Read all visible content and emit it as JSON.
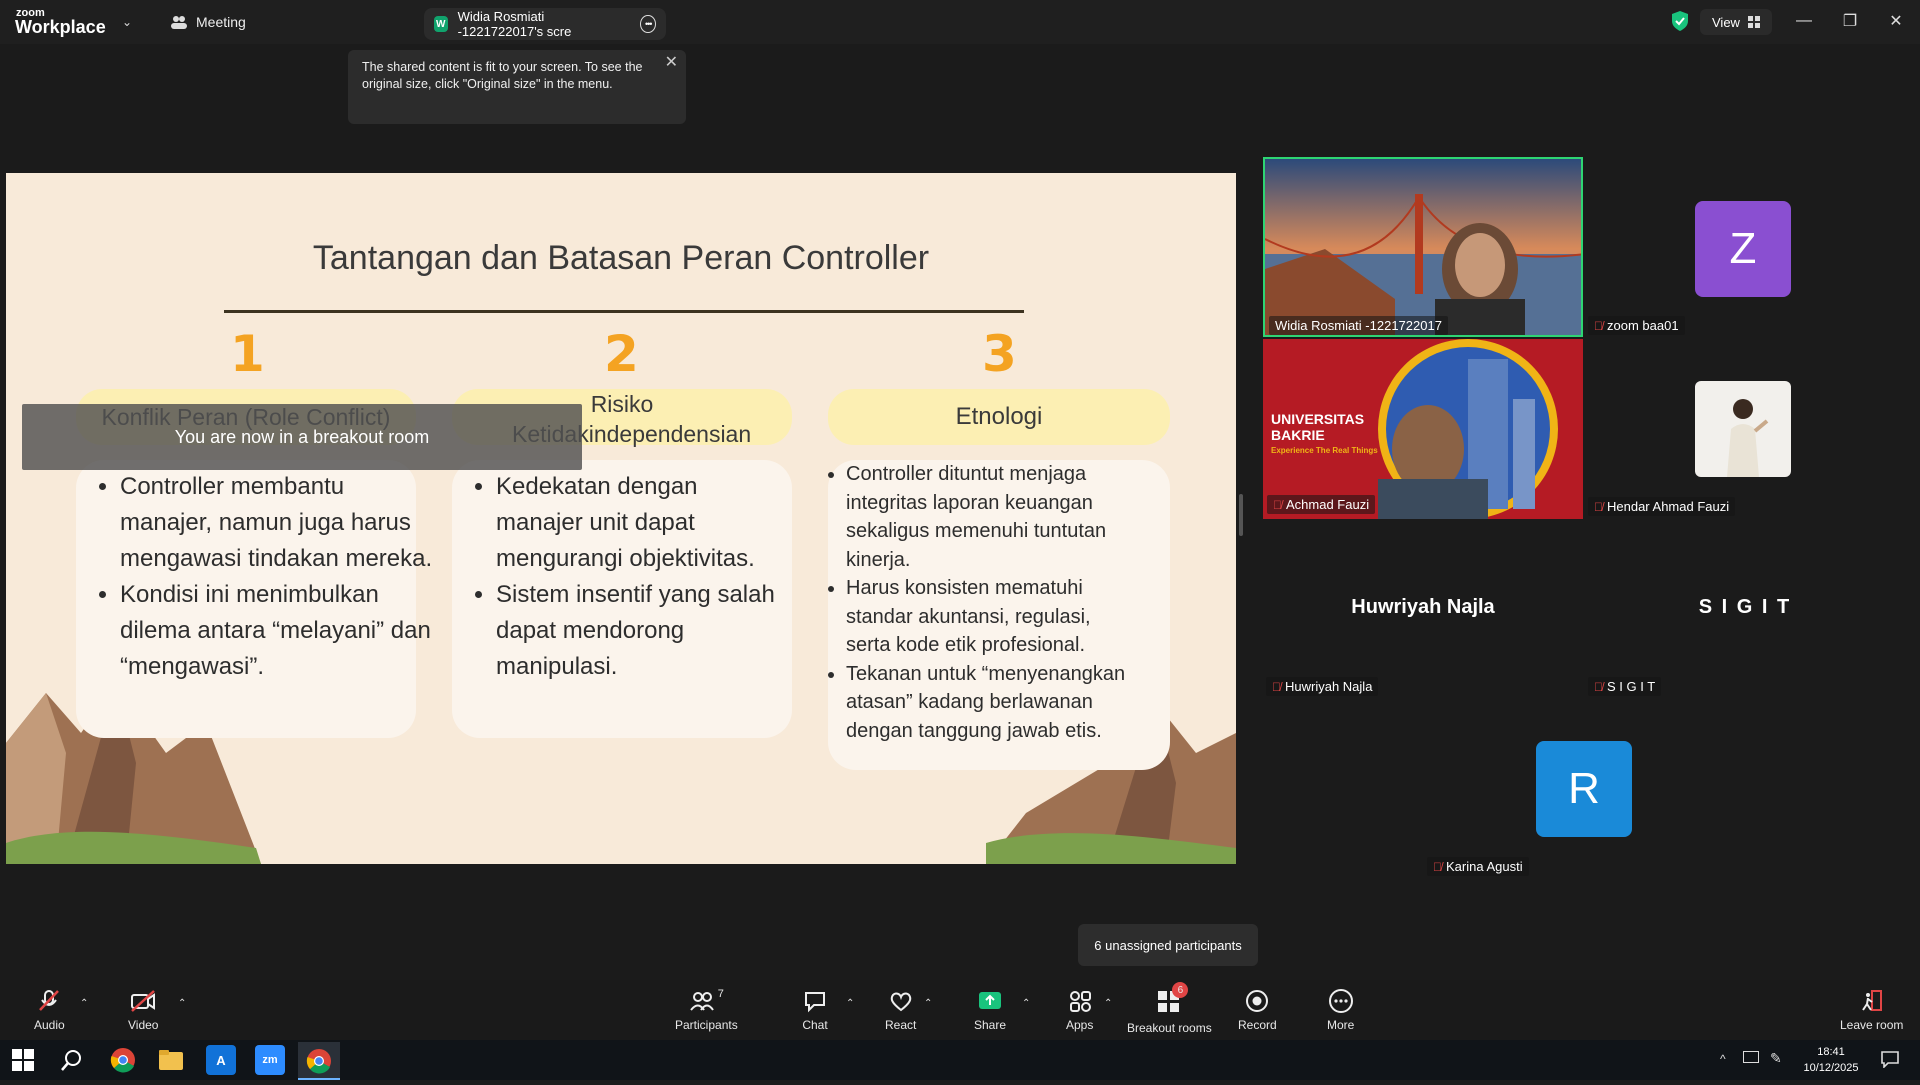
{
  "topbar": {
    "logo_small": "zoom",
    "logo_big": "Workplace",
    "meeting_label": "Meeting",
    "share_tab_badge": "W",
    "share_tab_label": "Widia Rosmiati -1221722017's scre",
    "view_label": "View",
    "tooltip_text": "The shared content is fit to your screen. To see the original size, click \"Original size\" in the menu."
  },
  "slide": {
    "title": "Tantangan dan Batasan Peran Controller",
    "columns": [
      {
        "number": "1",
        "heading": "Konflik Peran (Role Conflict)",
        "bullets": [
          "Controller membantu manajer, namun juga harus mengawasi tindakan mereka.",
          "Kondisi ini menimbulkan dilema antara “melayani” dan “mengawasi”."
        ]
      },
      {
        "number": "2",
        "heading": "Risiko Ketidakindependensian",
        "bullets": [
          "Kedekatan dengan manajer unit dapat mengurangi objektivitas.",
          "Sistem insentif yang salah dapat mendorong manipulasi."
        ]
      },
      {
        "number": "3",
        "heading": "Etnologi",
        "bullets": [
          "Controller dituntut menjaga integritas laporan keuangan sekaligus memenuhi tuntutan kinerja.",
          "Harus konsisten mematuhi standar akuntansi, regulasi, serta kode etik profesional.",
          "Tekanan untuk “menyenangkan atasan” kadang berlawanan dengan tanggung jawab etis."
        ]
      }
    ],
    "breakout_message": "You are now in a breakout room"
  },
  "participants": {
    "widia": "Widia Rosmiati -1221722017",
    "zoom_baa": "zoom baa01",
    "zoom_baa_initial": "Z",
    "achmad": "Achmad Fauzi",
    "hendar": "Hendar Ahmad Fauzi",
    "huwriyah_big": "Huwriyah Najla",
    "huwriyah": "Huwriyah Najla",
    "sigit_big": "S I G I T",
    "sigit": "S I G I T",
    "karina": "Karina Agusti",
    "karina_initial": "R",
    "bakrie_line1": "UNIVERSITAS",
    "bakrie_line2": "BAKRIE",
    "bakrie_tag": "Experience The Real Things"
  },
  "breakout_tooltip": "6 unassigned participants",
  "toolbar": {
    "audio": "Audio",
    "video": "Video",
    "participants": "Participants",
    "participants_count": "7",
    "chat": "Chat",
    "react": "React",
    "share": "Share",
    "apps": "Apps",
    "breakout": "Breakout rooms",
    "breakout_badge": "6",
    "record": "Record",
    "more": "More",
    "leave": "Leave room"
  },
  "taskbar": {
    "time": "18:41",
    "date": "10/12/2025",
    "zoom_icon_label": "zm"
  },
  "colors": {
    "accent_green": "#19c37d",
    "slide_bg": "#f8ead9",
    "number_orange": "#f4a322",
    "avatar_purple": "#8a4fd1",
    "avatar_blue": "#1a8ad8"
  }
}
